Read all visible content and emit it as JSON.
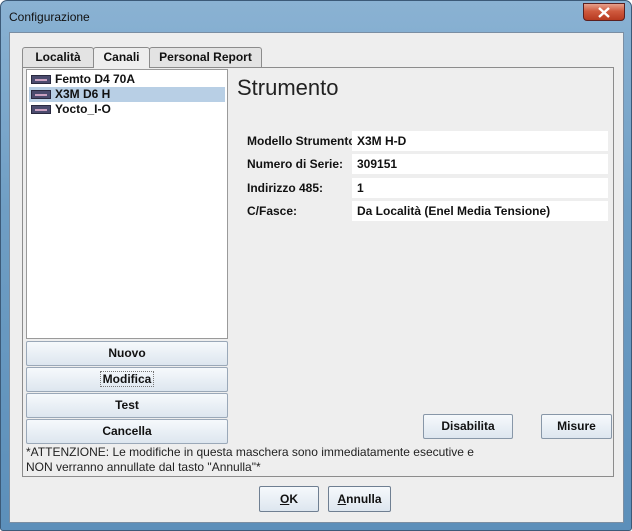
{
  "window": {
    "title": "Configurazione",
    "close_icon": "close-icon"
  },
  "tabs": [
    {
      "label": "Località",
      "active": false
    },
    {
      "label": "Canali",
      "active": true
    },
    {
      "label": "Personal Report",
      "active": false
    }
  ],
  "device_list": {
    "items": [
      {
        "label": "Femto D4 70A",
        "selected": false,
        "icon": "device-icon"
      },
      {
        "label": "X3M D6 H",
        "selected": true,
        "icon": "device-icon"
      },
      {
        "label": "Yocto_I-O",
        "selected": false,
        "icon": "device-icon"
      }
    ]
  },
  "list_buttons": {
    "nuovo": "Nuovo",
    "modifica": "Modifica",
    "test": "Test",
    "cancella": "Cancella"
  },
  "detail": {
    "heading": "Strumento",
    "fields": [
      {
        "label": "Modello Strumento:",
        "value": "X3M H-D"
      },
      {
        "label": "Numero di Serie:",
        "value": "309151"
      },
      {
        "label": "Indirizzo 485:",
        "value": "1"
      },
      {
        "label": "C/Fasce:",
        "value": "Da Località (Enel Media Tensione)"
      }
    ],
    "disable_button": "Disabilita",
    "measures_button": "Misure"
  },
  "note": {
    "line1": "*ATTENZIONE: Le modifiche in questa maschera sono immediatamente esecutive e",
    "line2": "NON verranno annullate dal tasto \"Annulla\"*"
  },
  "footer": {
    "ok_mnemonic": "O",
    "ok_rest": "K",
    "cancel_mnemonic": "A",
    "cancel_rest": "nnulla"
  }
}
